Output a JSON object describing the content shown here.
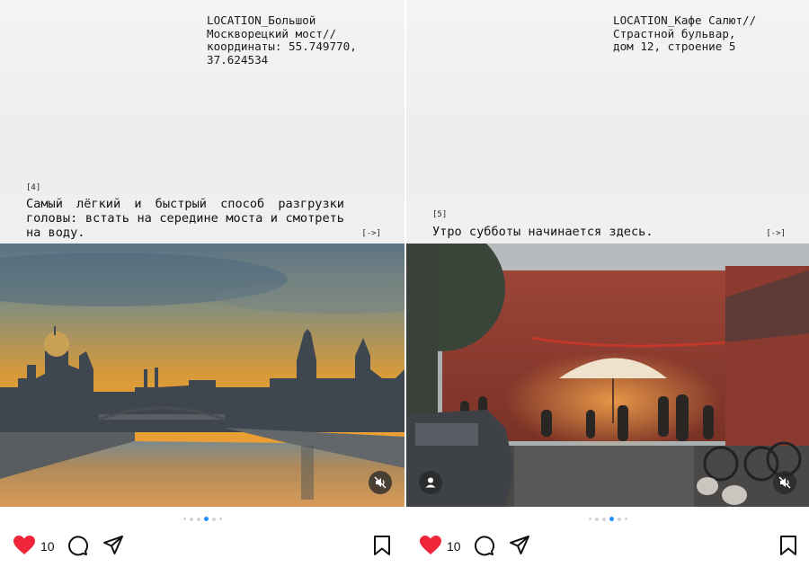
{
  "posts": [
    {
      "location": "LOCATION_Большой\nМоскворецкий мост//\nкоординаты: 55.749770,\n37.624534",
      "number": "[4]",
      "caption": "Самый лёгкий и быстрый способ разгрузки головы: встать на середине моста и смотреть на воду.",
      "next_label": "[->]",
      "likes": "10",
      "carousel": {
        "total": 6,
        "active_index": 3
      },
      "icons": {
        "like": "heart-icon",
        "comment": "comment-icon",
        "share": "share-icon",
        "save": "bookmark-icon",
        "sound": "mute-icon"
      },
      "colors": {
        "heart": "#f0243a",
        "active_dot": "#1e90ff"
      }
    },
    {
      "location": "LOCATION_Кафе Салют//\nСтрастной бульвар,\nдом 12, строение 5",
      "number": "[5]",
      "caption": "Утро субботы начинается здесь.",
      "next_label": "[->]",
      "likes": "10",
      "carousel": {
        "total": 6,
        "active_index": 3
      },
      "icons": {
        "like": "heart-icon",
        "comment": "comment-icon",
        "share": "share-icon",
        "save": "bookmark-icon",
        "sound": "mute-icon",
        "tagged": "user-icon"
      },
      "colors": {
        "heart": "#f0243a",
        "active_dot": "#1e90ff"
      }
    }
  ]
}
